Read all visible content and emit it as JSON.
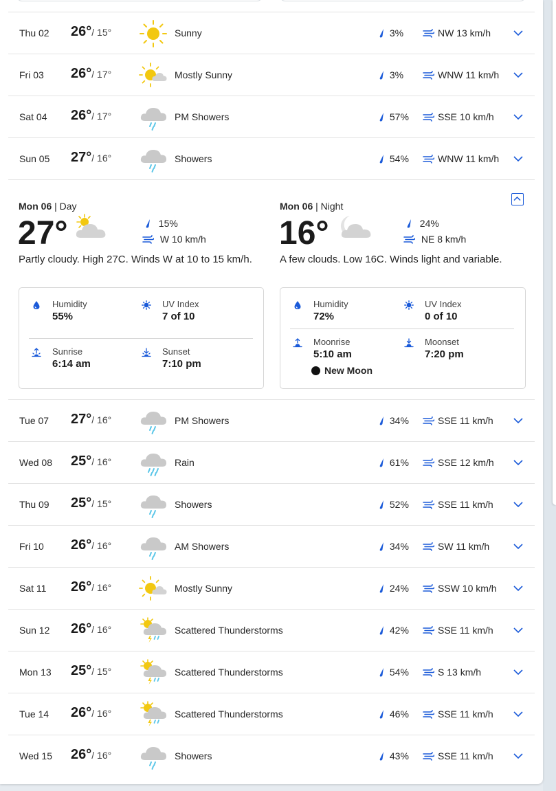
{
  "colors": {
    "accent": "#1a5ad9",
    "sun": "#f2c811",
    "cloud": "#c9c9c9",
    "rain": "#5bc6e8",
    "text": "#262626"
  },
  "forecast": {
    "rows_before": [
      {
        "day": "Thu 02",
        "high": "26°",
        "low": "/ 15°",
        "icon": "sunny-icon",
        "condition": "Sunny",
        "precip": "3%",
        "wind": "NW 13 km/h"
      },
      {
        "day": "Fri 03",
        "high": "26°",
        "low": "/ 17°",
        "icon": "mostly-sunny-icon",
        "condition": "Mostly Sunny",
        "precip": "3%",
        "wind": "WNW 11 km/h"
      },
      {
        "day": "Sat 04",
        "high": "26°",
        "low": "/ 17°",
        "icon": "showers-icon",
        "condition": "PM Showers",
        "precip": "57%",
        "wind": "SSE 10 km/h"
      },
      {
        "day": "Sun 05",
        "high": "27°",
        "low": "/ 16°",
        "icon": "showers-icon",
        "condition": "Showers",
        "precip": "54%",
        "wind": "WNW 11 km/h"
      }
    ],
    "expanded": {
      "day": {
        "title_day": "Mon 06",
        "title_part": "Day",
        "temp": "27°",
        "icon": "partly-cloudy-day-icon",
        "precip": "15%",
        "wind": "W 10 km/h",
        "summary": "Partly cloudy. High 27C. Winds W at 10 to 15 km/h.",
        "humidity_label": "Humidity",
        "humidity": "55%",
        "uv_label": "UV Index",
        "uv": "7 of 10",
        "rise_label": "Sunrise",
        "rise": "6:14 am",
        "set_label": "Sunset",
        "set": "7:10 pm"
      },
      "night": {
        "title_day": "Mon 06",
        "title_part": "Night",
        "temp": "16°",
        "icon": "partly-cloudy-night-icon",
        "precip": "24%",
        "wind": "NE 8 km/h",
        "summary": "A few clouds. Low 16C. Winds light and variable.",
        "humidity_label": "Humidity",
        "humidity": "72%",
        "uv_label": "UV Index",
        "uv": "0 of 10",
        "rise_label": "Moonrise",
        "rise": "5:10 am",
        "set_label": "Moonset",
        "set": "7:20 pm",
        "moon_phase": "New Moon"
      }
    },
    "rows_after": [
      {
        "day": "Tue 07",
        "high": "27°",
        "low": "/ 16°",
        "icon": "showers-icon",
        "condition": "PM Showers",
        "precip": "34%",
        "wind": "SSE 11 km/h"
      },
      {
        "day": "Wed 08",
        "high": "25°",
        "low": "/ 16°",
        "icon": "rain-icon",
        "condition": "Rain",
        "precip": "61%",
        "wind": "SSE 12 km/h"
      },
      {
        "day": "Thu 09",
        "high": "25°",
        "low": "/ 15°",
        "icon": "showers-icon",
        "condition": "Showers",
        "precip": "52%",
        "wind": "SSE 11 km/h"
      },
      {
        "day": "Fri 10",
        "high": "26°",
        "low": "/ 16°",
        "icon": "showers-icon",
        "condition": "AM Showers",
        "precip": "34%",
        "wind": "SW 11 km/h"
      },
      {
        "day": "Sat 11",
        "high": "26°",
        "low": "/ 16°",
        "icon": "mostly-sunny-icon",
        "condition": "Mostly Sunny",
        "precip": "24%",
        "wind": "SSW 10 km/h"
      },
      {
        "day": "Sun 12",
        "high": "26°",
        "low": "/ 16°",
        "icon": "thunderstorm-icon",
        "condition": "Scattered Thunderstorms",
        "precip": "42%",
        "wind": "SSE 11 km/h"
      },
      {
        "day": "Mon 13",
        "high": "25°",
        "low": "/ 15°",
        "icon": "thunderstorm-icon",
        "condition": "Scattered Thunderstorms",
        "precip": "54%",
        "wind": "S 13 km/h"
      },
      {
        "day": "Tue 14",
        "high": "26°",
        "low": "/ 16°",
        "icon": "thunderstorm-icon",
        "condition": "Scattered Thunderstorms",
        "precip": "46%",
        "wind": "SSE 11 km/h"
      },
      {
        "day": "Wed 15",
        "high": "26°",
        "low": "/ 16°",
        "icon": "showers-icon",
        "condition": "Showers",
        "precip": "43%",
        "wind": "SSE 11 km/h"
      }
    ]
  }
}
